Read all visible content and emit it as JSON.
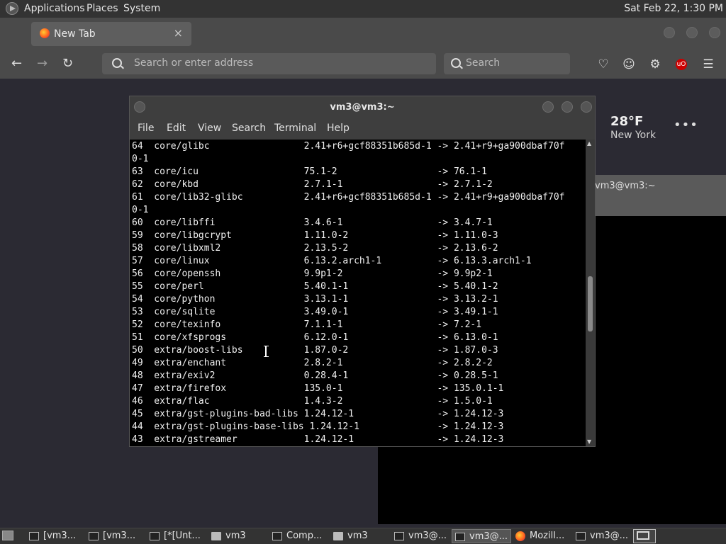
{
  "top_panel": {
    "menus": [
      "Applications",
      "Places",
      "System"
    ],
    "clock": "Sat Feb 22,  1:30 PM"
  },
  "firefox": {
    "tab_title": "New Tab",
    "tab_close": "×",
    "url_placeholder": "Search or enter address",
    "search_placeholder": "Search",
    "weather_temp": "28°F",
    "weather_city": "New York",
    "weather_more": "•••"
  },
  "bg_terminal": {
    "title": "vm3@vm3:~"
  },
  "terminal": {
    "title": "vm3@vm3:~",
    "menu": [
      "File",
      "Edit",
      "View",
      "Search",
      "Terminal",
      "Help"
    ],
    "lines": [
      "64  core/glibc                 2.41+r6+gcf88351b685d-1 -> 2.41+r9+ga900dbaf70f",
      "0-1",
      "63  core/icu                   75.1-2                  -> 76.1-1",
      "62  core/kbd                   2.7.1-1                 -> 2.7.1-2",
      "61  core/lib32-glibc           2.41+r6+gcf88351b685d-1 -> 2.41+r9+ga900dbaf70f",
      "0-1",
      "60  core/libffi                3.4.6-1                 -> 3.4.7-1",
      "59  core/libgcrypt             1.11.0-2                -> 1.11.0-3",
      "58  core/libxml2               2.13.5-2                -> 2.13.6-2",
      "57  core/linux                 6.13.2.arch1-1          -> 6.13.3.arch1-1",
      "56  core/openssh               9.9p1-2                 -> 9.9p2-1",
      "55  core/perl                  5.40.1-1                -> 5.40.1-2",
      "54  core/python                3.13.1-1                -> 3.13.2-1",
      "53  core/sqlite                3.49.0-1                -> 3.49.1-1",
      "52  core/texinfo               7.1.1-1                 -> 7.2-1",
      "51  core/xfsprogs              6.12.0-1                -> 6.13.0-1",
      "50  extra/boost-libs           1.87.0-2                -> 1.87.0-3",
      "49  extra/enchant              2.8.2-1                 -> 2.8.2-2",
      "48  extra/exiv2                0.28.4-1                -> 0.28.5-1",
      "47  extra/firefox              135.0-1                 -> 135.0.1-1",
      "46  extra/flac                 1.4.3-2                 -> 1.5.0-1",
      "45  extra/gst-plugins-bad-libs 1.24.12-1               -> 1.24.12-3",
      "44  extra/gst-plugins-base-libs 1.24.12-1              -> 1.24.12-3",
      "43  extra/gstreamer            1.24.12-1               -> 1.24.12-3"
    ]
  },
  "taskbar": {
    "items": [
      {
        "label": "[vm3...",
        "icon": "terminal-icon"
      },
      {
        "label": "[vm3...",
        "icon": "terminal-icon"
      },
      {
        "label": "[*[Unt...",
        "icon": "editor-icon"
      },
      {
        "label": "vm3",
        "icon": "folder-icon"
      },
      {
        "label": "Comp...",
        "icon": "computer-icon"
      },
      {
        "label": "vm3",
        "icon": "folder-icon"
      },
      {
        "label": "vm3@...",
        "icon": "terminal-icon"
      },
      {
        "label": "vm3@...",
        "icon": "terminal-icon"
      },
      {
        "label": "Mozill...",
        "icon": "firefox-icon"
      },
      {
        "label": "vm3@...",
        "icon": "terminal-icon"
      }
    ]
  }
}
